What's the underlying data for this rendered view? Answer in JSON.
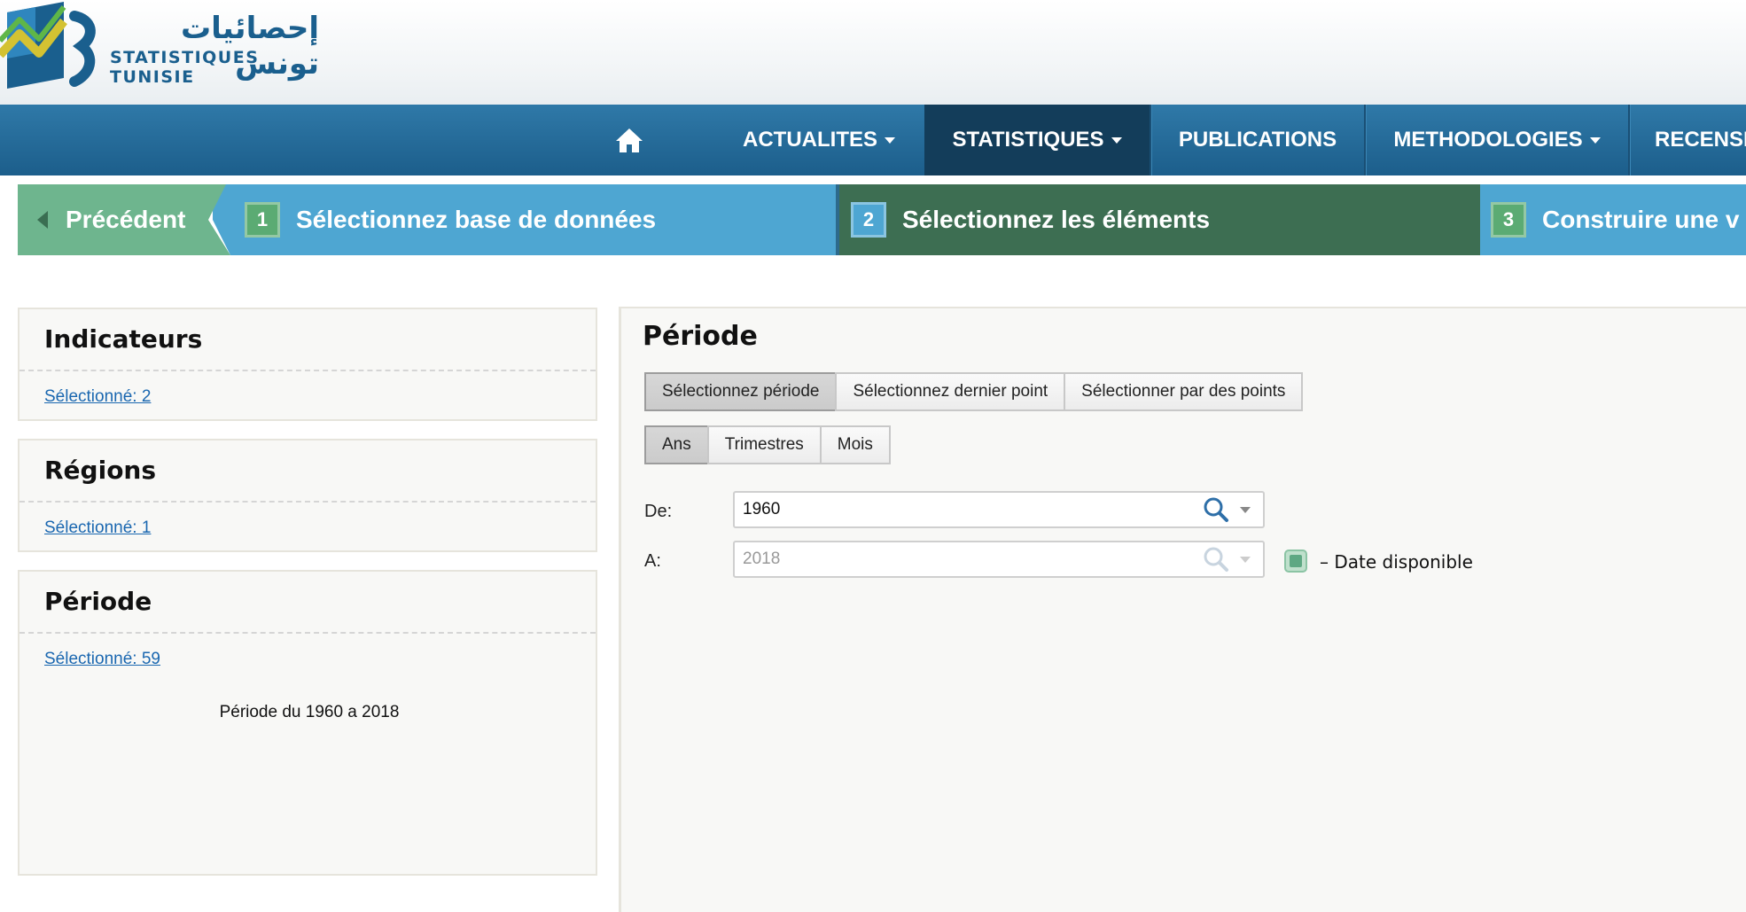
{
  "logo": {
    "arabic_text": "إحصائيات تونس",
    "french_text": "STATISTIQUES TUNISIE"
  },
  "nav": {
    "home_icon": "home-icon",
    "items": [
      {
        "label": "ACTUALITES",
        "dropdown": true
      },
      {
        "label": "STATISTIQUES",
        "dropdown": true,
        "active": true
      },
      {
        "label": "PUBLICATIONS",
        "dropdown": false
      },
      {
        "label": "METHODOLOGIES",
        "dropdown": true
      },
      {
        "label": "RECENSI",
        "dropdown": false
      }
    ]
  },
  "steps": {
    "back_label": "Précédent",
    "items": [
      {
        "number": "1",
        "label": "Sélectionnez base de données"
      },
      {
        "number": "2",
        "label": "Sélectionnez les éléments"
      },
      {
        "number": "3",
        "label": "Construire une v"
      }
    ]
  },
  "sidebar": {
    "panels": [
      {
        "title": "Indicateurs",
        "link": "Sélectionné: 2"
      },
      {
        "title": "Régions",
        "link": "Sélectionné: 1"
      },
      {
        "title": "Période",
        "link": "Sélectionné: 59",
        "note": "Période du 1960 a 2018"
      }
    ]
  },
  "main": {
    "title": "Période",
    "mode_buttons": [
      "Sélectionnez période",
      "Sélectionnez dernier point",
      "Sélectionner par des points"
    ],
    "active_mode": "Sélectionnez période",
    "frequency_buttons": [
      "Ans",
      "Trimestres",
      "Mois"
    ],
    "active_frequency": "Ans",
    "from_label": "De:",
    "from_value": "1960",
    "to_label": "A:",
    "to_value": "2018",
    "legend_text": "– Date disponible"
  },
  "colors": {
    "nav_bg": "#1c5e8b",
    "nav_active": "#133d5a",
    "step_back": "#6eb58e",
    "step1": "#4ea6d2",
    "step2": "#3d6e52",
    "step3": "#4ea6d2",
    "link": "#1a67b0"
  }
}
